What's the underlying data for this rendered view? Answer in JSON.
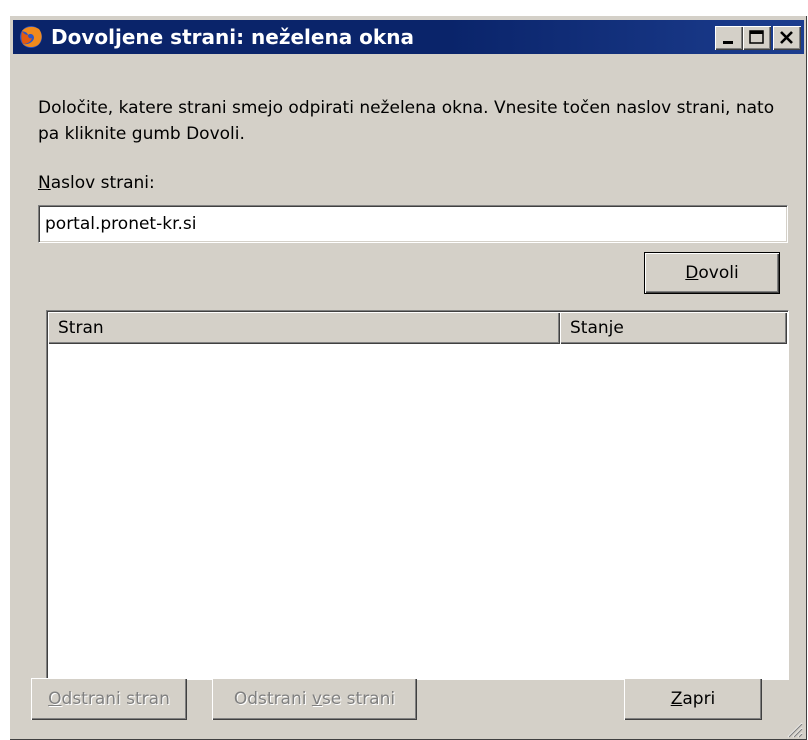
{
  "window": {
    "title": "Dovoljene strani: neželena okna",
    "controls": [
      "minimize-icon",
      "maximize-icon",
      "close-icon"
    ]
  },
  "dialog": {
    "description": "Določite, katere strani smejo odpirati neželena okna. Vnesite točen naslov strani, nato pa kliknite gumb Dovoli.",
    "address_label": "Naslov strani:",
    "address_value": "portal.pronet-kr.si",
    "allow_button": "Dovoli",
    "list": {
      "columns": [
        "Stran",
        "Stanje"
      ],
      "rows": []
    },
    "remove_button": "Odstrani stran",
    "remove_all_button": "Odstrani vse strani",
    "close_button": "Zapri"
  },
  "colors": {
    "titlebar": "#0a246a",
    "face": "#d4d0c8",
    "disabled_text": "#808080"
  }
}
